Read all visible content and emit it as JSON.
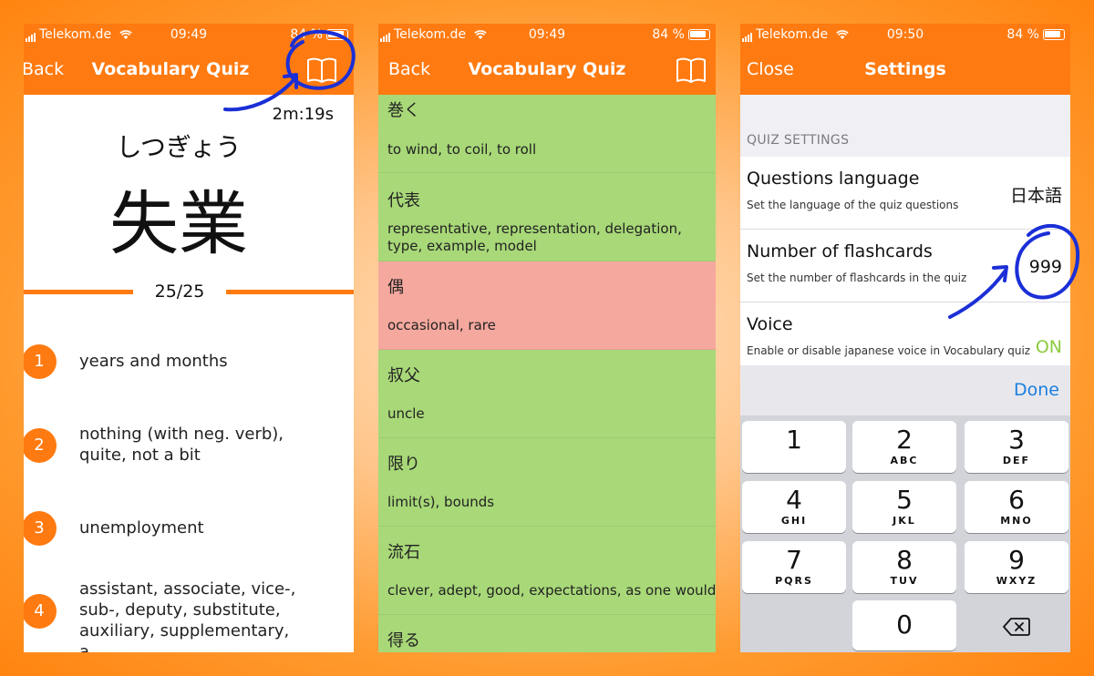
{
  "colors": {
    "orange": "#ff7a10",
    "green_row": "#a8d878",
    "red_row": "#f5a89e",
    "on_green": "#8ccb3e",
    "done_blue": "#1d7fe0",
    "annotation_blue": "#1b2fd6"
  },
  "screens": [
    {
      "status": {
        "carrier": "Telekom.de",
        "time": "09:49",
        "battery": "84 %"
      },
      "nav": {
        "back": "Back",
        "title": "Vocabulary Quiz",
        "icon": "book-icon"
      },
      "timer": "2m:19s",
      "word": {
        "kana": "しつぎょう",
        "kanji": "失業"
      },
      "progress": {
        "text": "25/25"
      },
      "answers": [
        {
          "num": "1",
          "text": "years and months"
        },
        {
          "num": "2",
          "text": "nothing (with neg. verb), quite, not a bit"
        },
        {
          "num": "3",
          "text": "unemployment"
        },
        {
          "num": "4",
          "text": "assistant, associate, vice-, sub-, deputy, substitute, auxiliary, supplementary, a..."
        }
      ]
    },
    {
      "status": {
        "carrier": "Telekom.de",
        "time": "09:49",
        "battery": "84 %"
      },
      "nav": {
        "back": "Back",
        "title": "Vocabulary Quiz",
        "icon": "book-icon"
      },
      "vocab": [
        {
          "word": "巻く",
          "meaning": "to wind, to coil, to roll",
          "state": "correct"
        },
        {
          "word": "代表",
          "meaning": "representative, representation, delegation, type, example, model",
          "state": "correct"
        },
        {
          "word": "偶",
          "meaning": "occasional, rare",
          "state": "wrong"
        },
        {
          "word": "叔父",
          "meaning": "uncle",
          "state": "correct"
        },
        {
          "word": "限り",
          "meaning": "limit(s), bounds",
          "state": "correct"
        },
        {
          "word": "流石",
          "meaning": "clever, adept, good, expectations, as one would e",
          "state": "correct"
        },
        {
          "word": "得る",
          "meaning": "",
          "state": "correct"
        }
      ]
    },
    {
      "status": {
        "carrier": "Telekom.de",
        "time": "09:50",
        "battery": "84 %"
      },
      "nav": {
        "close": "Close",
        "title": "Settings"
      },
      "section": "QUIZ SETTINGS",
      "settings": [
        {
          "title": "Questions language",
          "subtitle": "Set the language of the quiz questions",
          "value": "日本語"
        },
        {
          "title": "Number of flashcards",
          "subtitle": "Set the number of flashcards in the quiz",
          "value": "999"
        },
        {
          "title": "Voice",
          "subtitle": "Enable or disable japanese voice in Vocabulary quiz",
          "value": "ON"
        }
      ],
      "done": "Done",
      "keypad": [
        {
          "digit": "1",
          "letters": ""
        },
        {
          "digit": "2",
          "letters": "ABC"
        },
        {
          "digit": "3",
          "letters": "DEF"
        },
        {
          "digit": "4",
          "letters": "GHI"
        },
        {
          "digit": "5",
          "letters": "JKL"
        },
        {
          "digit": "6",
          "letters": "MNO"
        },
        {
          "digit": "7",
          "letters": "PQRS"
        },
        {
          "digit": "8",
          "letters": "TUV"
        },
        {
          "digit": "9",
          "letters": "WXYZ"
        },
        {
          "digit": "0",
          "letters": ""
        }
      ],
      "delete_icon": "backspace-icon"
    }
  ]
}
